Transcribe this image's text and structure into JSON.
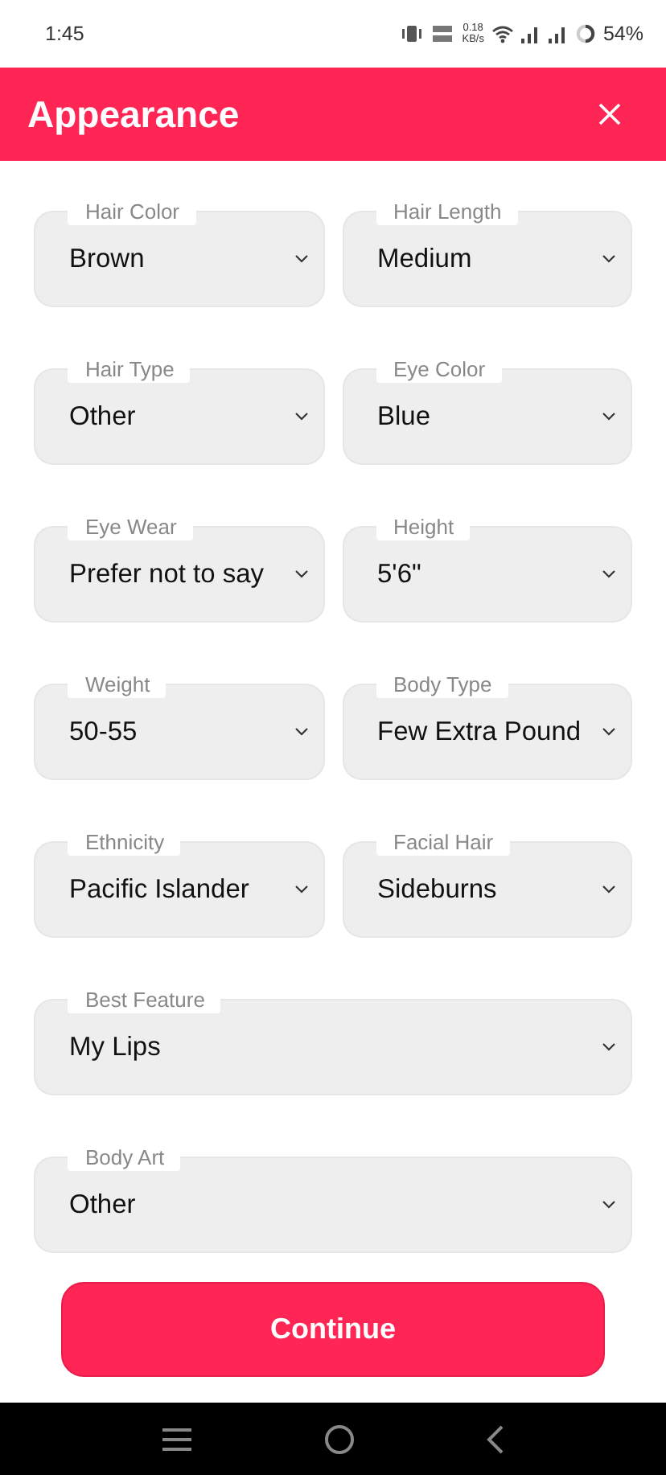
{
  "status_bar": {
    "time": "1:45",
    "speed": "0.18",
    "speed_unit": "KB/s",
    "battery": "54%"
  },
  "header": {
    "title": "Appearance"
  },
  "fields": [
    {
      "label": "Hair Color",
      "value": "Brown",
      "kind": "half"
    },
    {
      "label": "Hair Length",
      "value": "Medium",
      "kind": "half"
    },
    {
      "label": "Hair Type",
      "value": "Other",
      "kind": "half"
    },
    {
      "label": "Eye Color",
      "value": "Blue",
      "kind": "half"
    },
    {
      "label": "Eye Wear",
      "value": "Prefer not to say",
      "kind": "half"
    },
    {
      "label": "Height",
      "value": "5'6\"",
      "kind": "half"
    },
    {
      "label": "Weight",
      "value": "50-55",
      "kind": "half"
    },
    {
      "label": "Body Type",
      "value": "Few Extra Pound",
      "kind": "half"
    },
    {
      "label": "Ethnicity",
      "value": "Pacific Islander",
      "kind": "half"
    },
    {
      "label": "Facial Hair",
      "value": "Sideburns",
      "kind": "half"
    },
    {
      "label": "Best Feature",
      "value": "My Lips",
      "kind": "full"
    },
    {
      "label": "Body Art",
      "value": "Other",
      "kind": "full"
    }
  ],
  "button": "Continue"
}
